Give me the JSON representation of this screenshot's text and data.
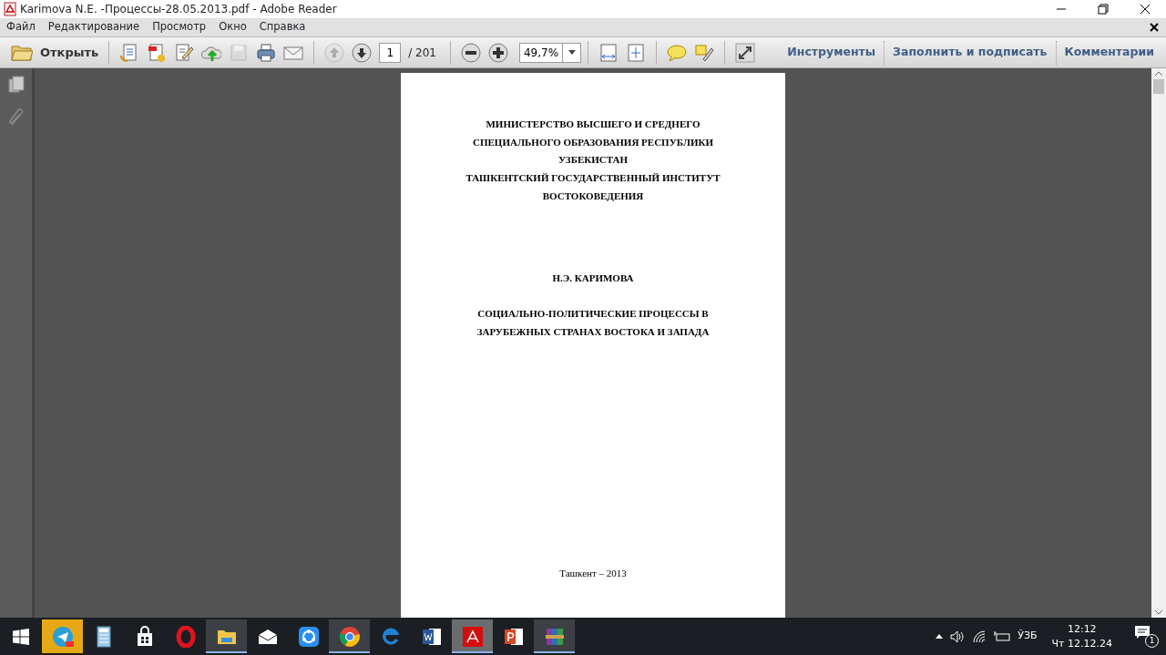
{
  "window": {
    "title": "Karimova N.E. -Процессы-28.05.2013.pdf - Adobe Reader"
  },
  "menu": [
    "Файл",
    "Редактирование",
    "Просмотр",
    "Окно",
    "Справка"
  ],
  "toolbar": {
    "open_label": "Открыть",
    "buttons": [
      {
        "kind": "create",
        "disabled": false
      },
      {
        "kind": "export",
        "disabled": false
      },
      {
        "kind": "edit",
        "disabled": false
      },
      {
        "kind": "cloud",
        "disabled": false
      },
      {
        "kind": "save",
        "disabled": true
      },
      {
        "kind": "print",
        "disabled": false
      },
      {
        "kind": "mail",
        "disabled": false
      }
    ],
    "nav": [
      {
        "kind": "up",
        "disabled": true
      },
      {
        "kind": "down",
        "disabled": false
      }
    ],
    "page": "1",
    "page_total": "/ 201",
    "zoom_buttons": [
      {
        "kind": "minus",
        "disabled": false
      },
      {
        "kind": "plus",
        "disabled": false
      }
    ],
    "zoom": "49,7%",
    "view_buttons": [
      {
        "kind": "fitwidth",
        "disabled": false
      },
      {
        "kind": "fitpage",
        "disabled": false
      },
      {
        "kind": "comment",
        "disabled": false
      },
      {
        "kind": "highlight",
        "disabled": false
      },
      {
        "kind": "expand",
        "disabled": false
      }
    ],
    "panes": [
      "Инструменты",
      "Заполнить и подписать",
      "Комментарии"
    ]
  },
  "document": {
    "lines": [
      {
        "kind": "heading",
        "text": "МИНИСТЕРСТВО ВЫСШЕГО И СРЕДНЕГО"
      },
      {
        "kind": "heading",
        "text": "СПЕЦИАЛЬНОГО ОБРАЗОВАНИЯ РЕСПУБЛИКИ"
      },
      {
        "kind": "heading",
        "text": "УЗБЕКИСТАН"
      },
      {
        "kind": "heading",
        "text": "ТАШКЕНТСКИЙ ГОСУДАРСТВЕННЫЙ ИНСТИТУТ"
      },
      {
        "kind": "heading",
        "text": "ВОСТОКОВЕДЕНИЯ"
      },
      {
        "kind": "author",
        "text": "Н.Э. КАРИМОВА"
      },
      {
        "kind": "title",
        "text": "СОЦИАЛЬНО-ПОЛИТИЧЕСКИЕ ПРОЦЕССЫ В"
      },
      {
        "kind": "title",
        "text": "ЗАРУБЕЖНЫХ СТРАНАХ ВОСТОКА И ЗАПАДА"
      },
      {
        "kind": "footer",
        "text": "Ташкент – 2013"
      }
    ]
  },
  "taskbar": {
    "apps": [
      {
        "kind": "telegram",
        "running": false,
        "attention": true,
        "selected": false
      },
      {
        "kind": "calculator",
        "running": false,
        "attention": false,
        "selected": false
      },
      {
        "kind": "store",
        "running": false,
        "attention": false,
        "selected": false
      },
      {
        "kind": "opera",
        "running": false,
        "attention": false,
        "selected": false
      },
      {
        "kind": "explorer",
        "running": true,
        "attention": false,
        "selected": false
      },
      {
        "kind": "mail",
        "running": false,
        "attention": false,
        "selected": false
      },
      {
        "kind": "share",
        "running": false,
        "attention": false,
        "selected": false
      },
      {
        "kind": "chrome",
        "running": true,
        "attention": false,
        "selected": false
      },
      {
        "kind": "edge",
        "running": false,
        "attention": false,
        "selected": false
      },
      {
        "kind": "word",
        "running": false,
        "attention": false,
        "selected": false
      },
      {
        "kind": "acrobat",
        "running": true,
        "attention": false,
        "selected": true
      },
      {
        "kind": "powerpoint",
        "running": false,
        "attention": false,
        "selected": false
      },
      {
        "kind": "winrar",
        "running": true,
        "attention": false,
        "selected": false
      }
    ],
    "language": "ЎЗБ",
    "time": "12:12",
    "date": "Чт 12.12.24",
    "notifications": "1"
  }
}
